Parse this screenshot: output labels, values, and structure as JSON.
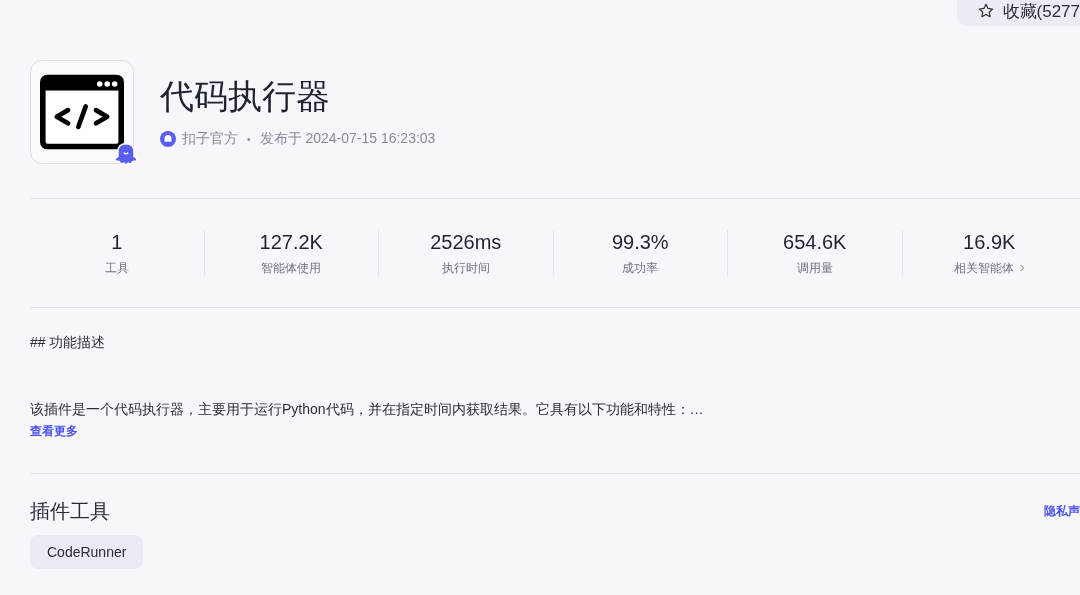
{
  "favorite_button": {
    "label": "收藏(5277"
  },
  "plugin": {
    "title": "代码执行器",
    "author": "扣子官方",
    "separator": "•",
    "published": "发布于 2024-07-15 16:23:03"
  },
  "stats": [
    {
      "value": "1",
      "label": "工具",
      "kind": "plain"
    },
    {
      "value": "127.2K",
      "label": "智能体使用",
      "kind": "plain"
    },
    {
      "value": "2526ms",
      "label": "执行时间",
      "kind": "plain"
    },
    {
      "value": "99.3%",
      "label": "成功率",
      "kind": "plain"
    },
    {
      "value": "654.6K",
      "label": "调用量",
      "kind": "plain"
    },
    {
      "value": "16.9K",
      "label": "相关智能体",
      "kind": "link"
    }
  ],
  "description": {
    "heading": "## 功能描述",
    "text": "该插件是一个代码执行器，主要用于运行Python代码，并在指定时间内获取结果。它具有以下功能和特性：…",
    "more_link": "查看更多"
  },
  "tools_section": {
    "title": "插件工具",
    "privacy_link": "隐私声",
    "tools": [
      {
        "label": "CodeRunner",
        "selected": false
      }
    ]
  }
}
